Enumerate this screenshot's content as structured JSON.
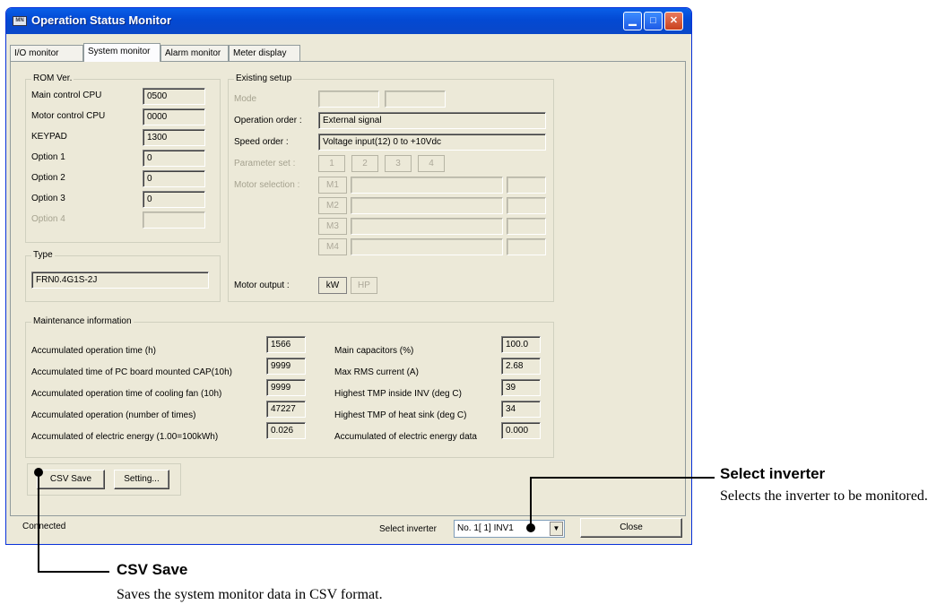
{
  "window": {
    "title": "Operation Status Monitor",
    "icon_text": "MN",
    "controls": {
      "minimize": "▁",
      "maximize": "□",
      "close": "✕"
    }
  },
  "tabs": [
    "I/O monitor",
    "System monitor",
    "Alarm monitor",
    "Meter display"
  ],
  "rom": {
    "title": "ROM Ver.",
    "rows": [
      {
        "label": "Main control CPU",
        "value": "0500",
        "enabled": true
      },
      {
        "label": "Motor control CPU",
        "value": "0000",
        "enabled": true
      },
      {
        "label": "KEYPAD",
        "value": "1300",
        "enabled": true
      },
      {
        "label": "Option 1",
        "value": "0",
        "enabled": true
      },
      {
        "label": "Option 2",
        "value": "0",
        "enabled": true
      },
      {
        "label": "Option 3",
        "value": "0",
        "enabled": true
      },
      {
        "label": "Option 4",
        "value": "",
        "enabled": false
      }
    ]
  },
  "type": {
    "title": "Type",
    "value": "FRN0.4G1S-2J"
  },
  "setup": {
    "title": "Existing setup",
    "mode_label": "Mode",
    "mode_values": [
      "",
      ""
    ],
    "operation_order_label": "Operation order :",
    "operation_order_value": "External signal",
    "speed_order_label": "Speed order :",
    "speed_order_value": "Voltage input(12) 0 to +10Vdc",
    "parameter_set_label": "Parameter set :",
    "parameter_sets": [
      "1",
      "2",
      "3",
      "4"
    ],
    "motor_selection_label": "Motor selection :",
    "motors": [
      "M1",
      "M2",
      "M3",
      "M4"
    ],
    "motor_output_label": "Motor output :",
    "motor_output_units": [
      "kW",
      "HP"
    ]
  },
  "maintenance": {
    "title": "Maintenance information",
    "left": [
      {
        "label": "Accumulated operation time (h)",
        "value": "1566"
      },
      {
        "label": "Accumulated time of PC board mounted CAP(10h)",
        "value": "9999"
      },
      {
        "label": "Accumulated operation time of cooling fan (10h)",
        "value": "9999"
      },
      {
        "label": "Accumulated operation (number of times)",
        "value": "47227"
      },
      {
        "label": "Accumulated of electric energy (1.00=100kWh)",
        "value": "0.026"
      }
    ],
    "right": [
      {
        "label": "Main capacitors (%)",
        "value": "100.0"
      },
      {
        "label": "Max RMS current (A)",
        "value": "2.68"
      },
      {
        "label": "Highest TMP inside INV (deg C)",
        "value": "39"
      },
      {
        "label": "Highest TMP of heat sink (deg C)",
        "value": "34"
      },
      {
        "label": "Accumulated of electric energy data",
        "value": "0.000"
      }
    ]
  },
  "buttons": {
    "csv_save": "CSV Save",
    "setting": "Setting...",
    "close": "Close"
  },
  "status": {
    "connection": "Connected",
    "select_inverter_label": "Select inverter",
    "select_inverter_value": "No. 1[ 1] INV1"
  },
  "callouts": {
    "select_inverter": {
      "title": "Select inverter",
      "text": "Selects the inverter to be monitored."
    },
    "csv_save": {
      "title": "CSV Save",
      "text": "Saves the system monitor data in CSV format."
    }
  }
}
